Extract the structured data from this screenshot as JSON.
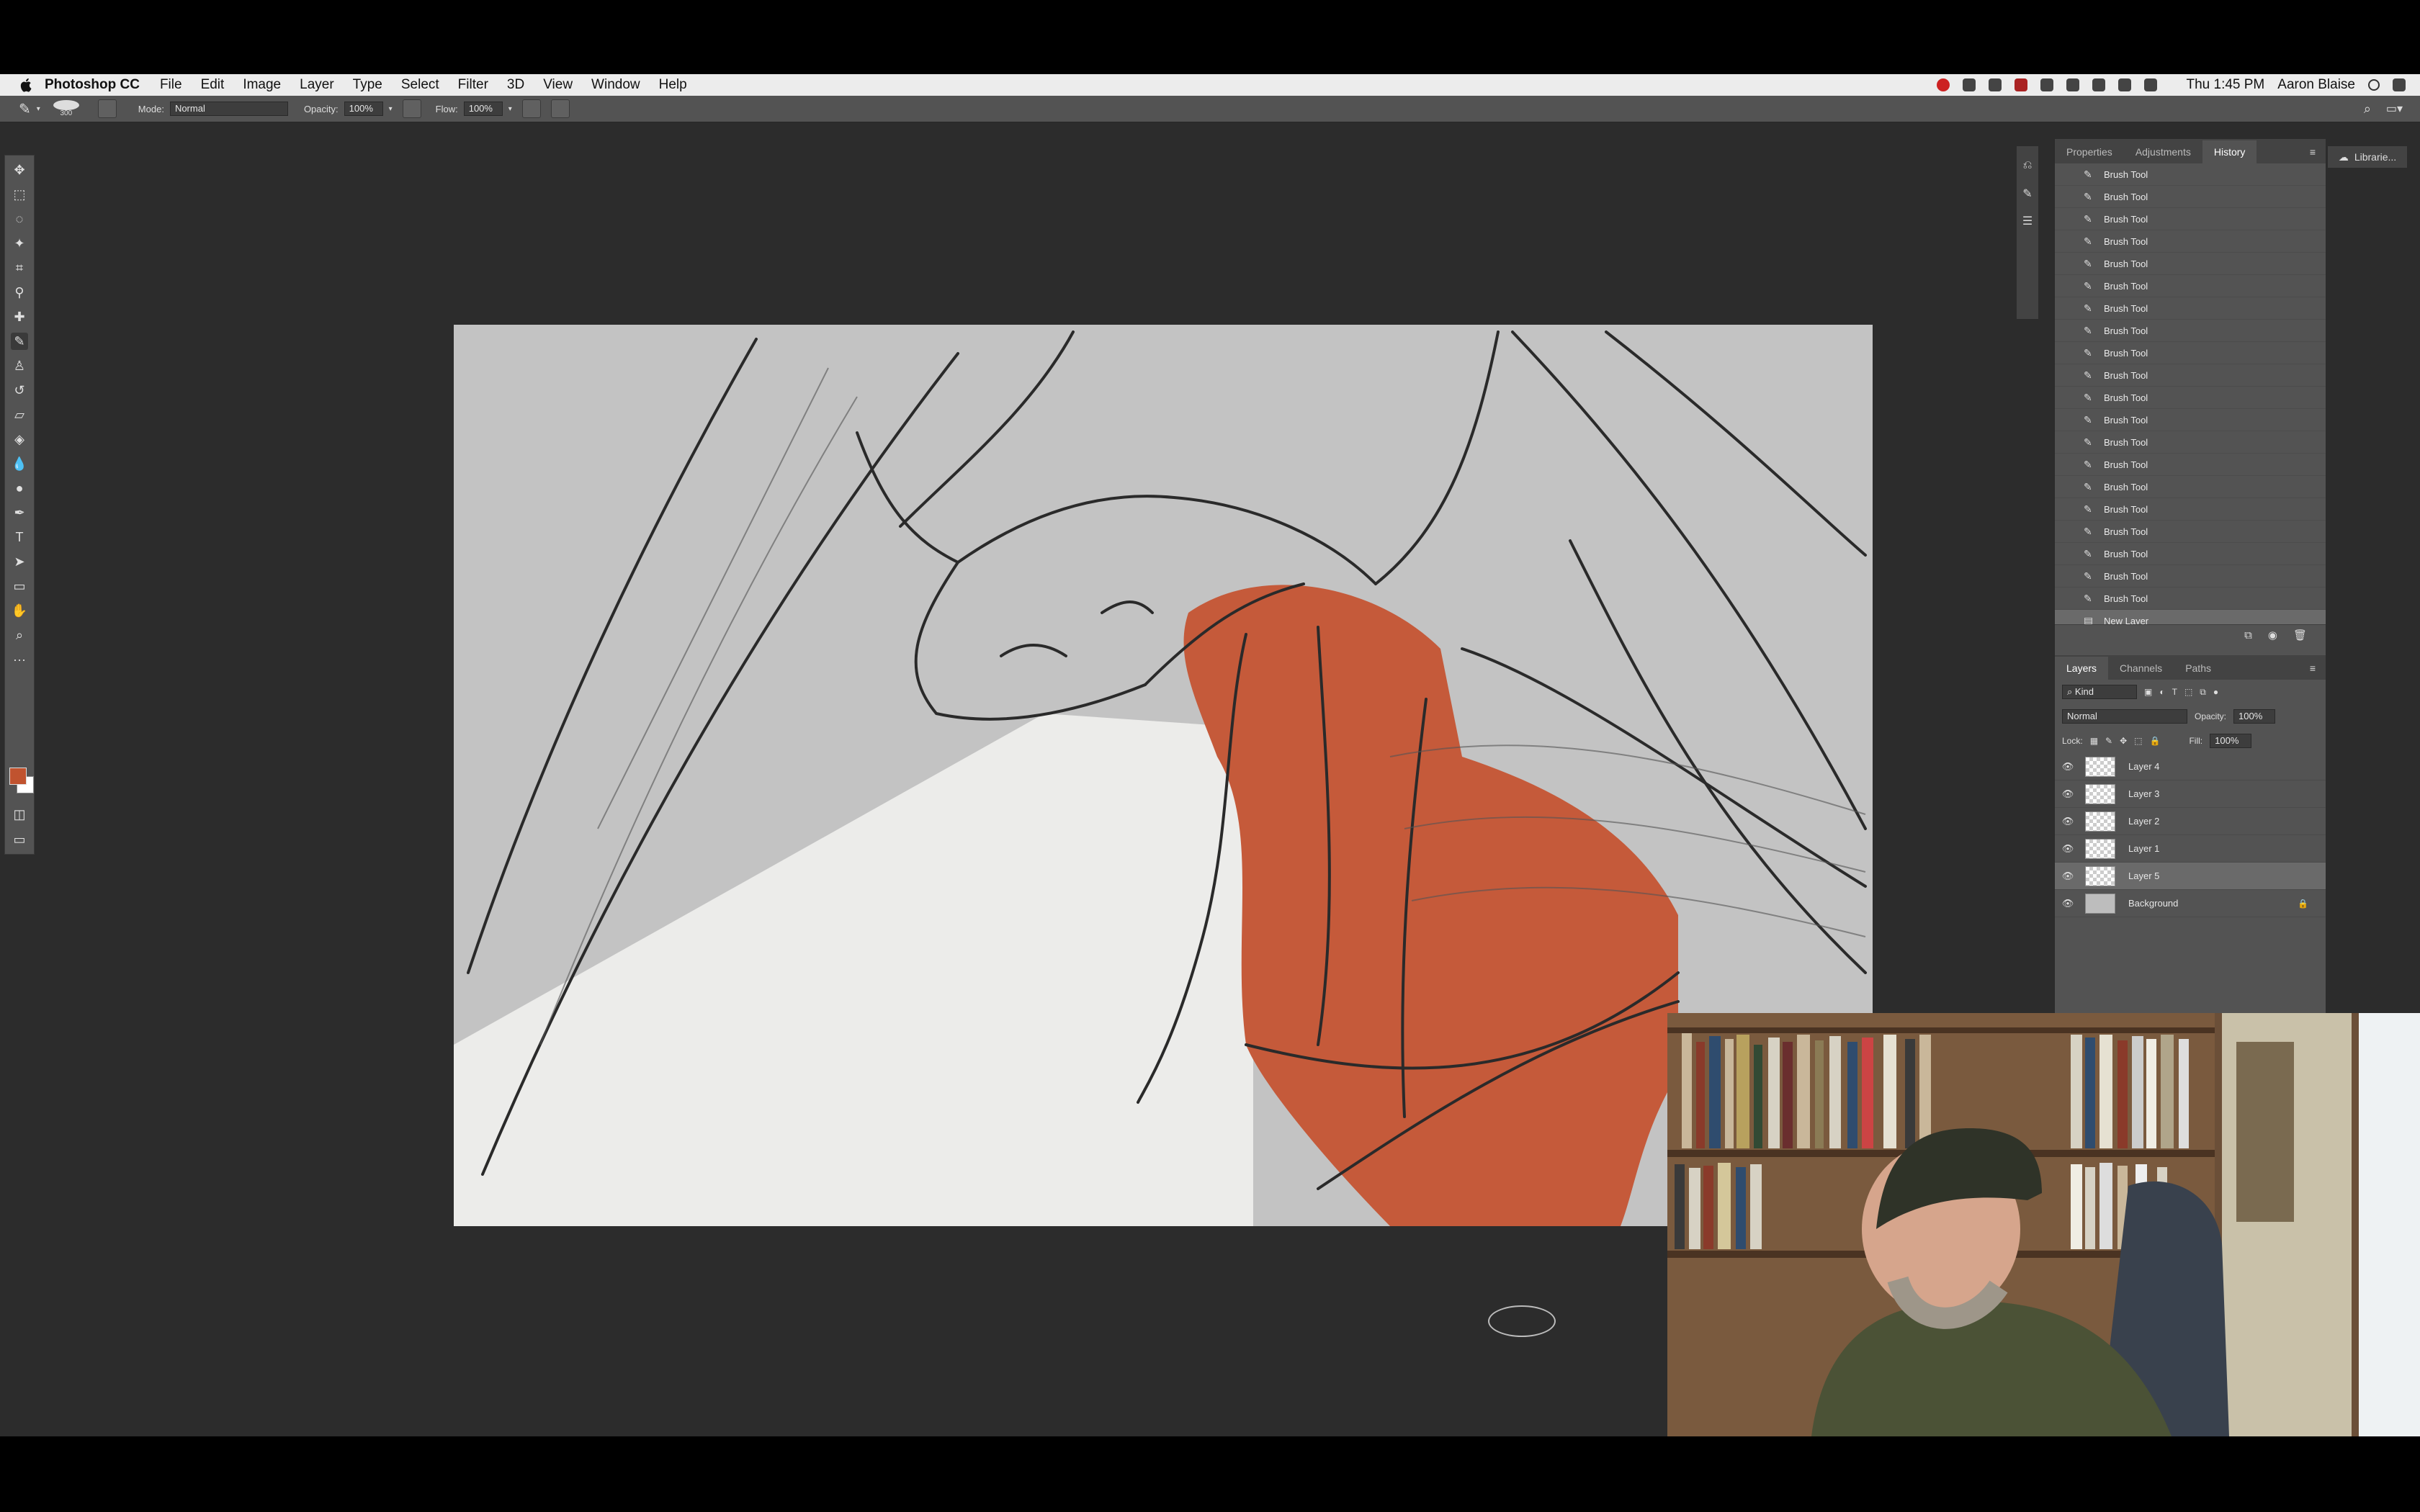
{
  "menubar": {
    "app_name": "Photoshop CC",
    "menus": [
      "File",
      "Edit",
      "Image",
      "Layer",
      "Type",
      "Select",
      "Filter",
      "3D",
      "View",
      "Window",
      "Help"
    ],
    "time": "Thu 1:45 PM",
    "user": "Aaron Blaise"
  },
  "options_bar": {
    "brush_size": "300",
    "mode_label": "Mode:",
    "mode_value": "Normal",
    "opacity_label": "Opacity:",
    "opacity_value": "100%",
    "flow_label": "Flow:",
    "flow_value": "100%"
  },
  "right_panel": {
    "tabs": [
      "Properties",
      "Adjustments",
      "History"
    ],
    "active_tab": "History",
    "history_items": [
      "Brush Tool",
      "Brush Tool",
      "Brush Tool",
      "Brush Tool",
      "Brush Tool",
      "Brush Tool",
      "Brush Tool",
      "Brush Tool",
      "Brush Tool",
      "Brush Tool",
      "Brush Tool",
      "Brush Tool",
      "Brush Tool",
      "Brush Tool",
      "Brush Tool",
      "Brush Tool",
      "Brush Tool",
      "Brush Tool",
      "Brush Tool",
      "Brush Tool",
      "New Layer"
    ]
  },
  "layers_panel": {
    "tabs": [
      "Layers",
      "Channels",
      "Paths"
    ],
    "filter_label": "Kind",
    "blend_mode": "Normal",
    "opacity_label": "Opacity:",
    "opacity_value": "100%",
    "lock_label": "Lock:",
    "fill_label": "Fill:",
    "fill_value": "100%",
    "layers": [
      "Layer 4",
      "Layer 3",
      "Layer 2",
      "Layer 1",
      "Layer 5",
      "Background"
    ],
    "selected_layer": "Layer 5"
  },
  "libraries_tab": "Librarie...",
  "colors": {
    "foreground": "#c0532f",
    "background": "#ffffff",
    "ui_dark": "#2c2c2c",
    "panel": "#535353"
  }
}
